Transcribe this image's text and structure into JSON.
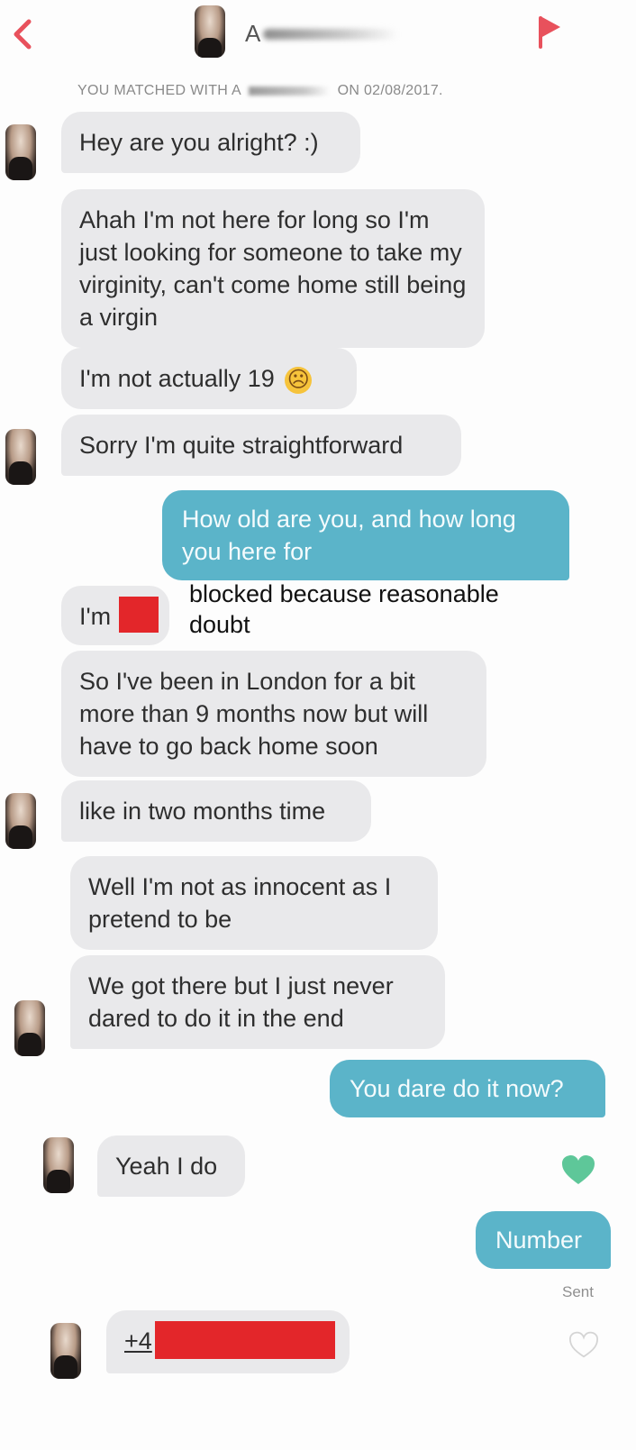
{
  "header": {
    "name_initial": "A",
    "back_icon": "chevron-left-icon",
    "flag_icon": "flag-icon",
    "accent": "#e8515c"
  },
  "match_banner": {
    "prefix": "YOU MATCHED WITH A",
    "suffix": "ON 02/08/2017."
  },
  "messages": [
    {
      "from": "them",
      "text": "Hey are you alright? :)"
    },
    {
      "from": "them",
      "text": "Ahah I'm not here for long so I'm just looking for someone to take my virginity, can't come home still being a virgin"
    },
    {
      "from": "them",
      "text": "I'm not actually 19",
      "emoji": "☹"
    },
    {
      "from": "them",
      "text": "Sorry I'm quite straightforward"
    },
    {
      "from": "me",
      "text": "How old are you, and how long you here for"
    },
    {
      "from": "them",
      "text": "I'm"
    },
    {
      "from": "them",
      "text": "So I've been in London for a bit more than 9 months now but will have to go back home soon"
    },
    {
      "from": "them",
      "text": "like in two months time"
    },
    {
      "from": "them",
      "text": "Well I'm not as innocent as I pretend to be"
    },
    {
      "from": "them",
      "text": "We got there but I just never dared to do it in the end"
    },
    {
      "from": "me",
      "text": "You dare do it now?"
    },
    {
      "from": "them",
      "text": "Yeah I do"
    },
    {
      "from": "me",
      "text": "Number"
    },
    {
      "from": "them",
      "text": "+4"
    }
  ],
  "annotation": "blocked because reasonable doubt",
  "sent_label": "Sent",
  "colors": {
    "incoming_bubble": "#e9e9eb",
    "outgoing_bubble": "#5bb4c9",
    "like_heart": "#5ec799",
    "redaction": "#e3262a"
  }
}
